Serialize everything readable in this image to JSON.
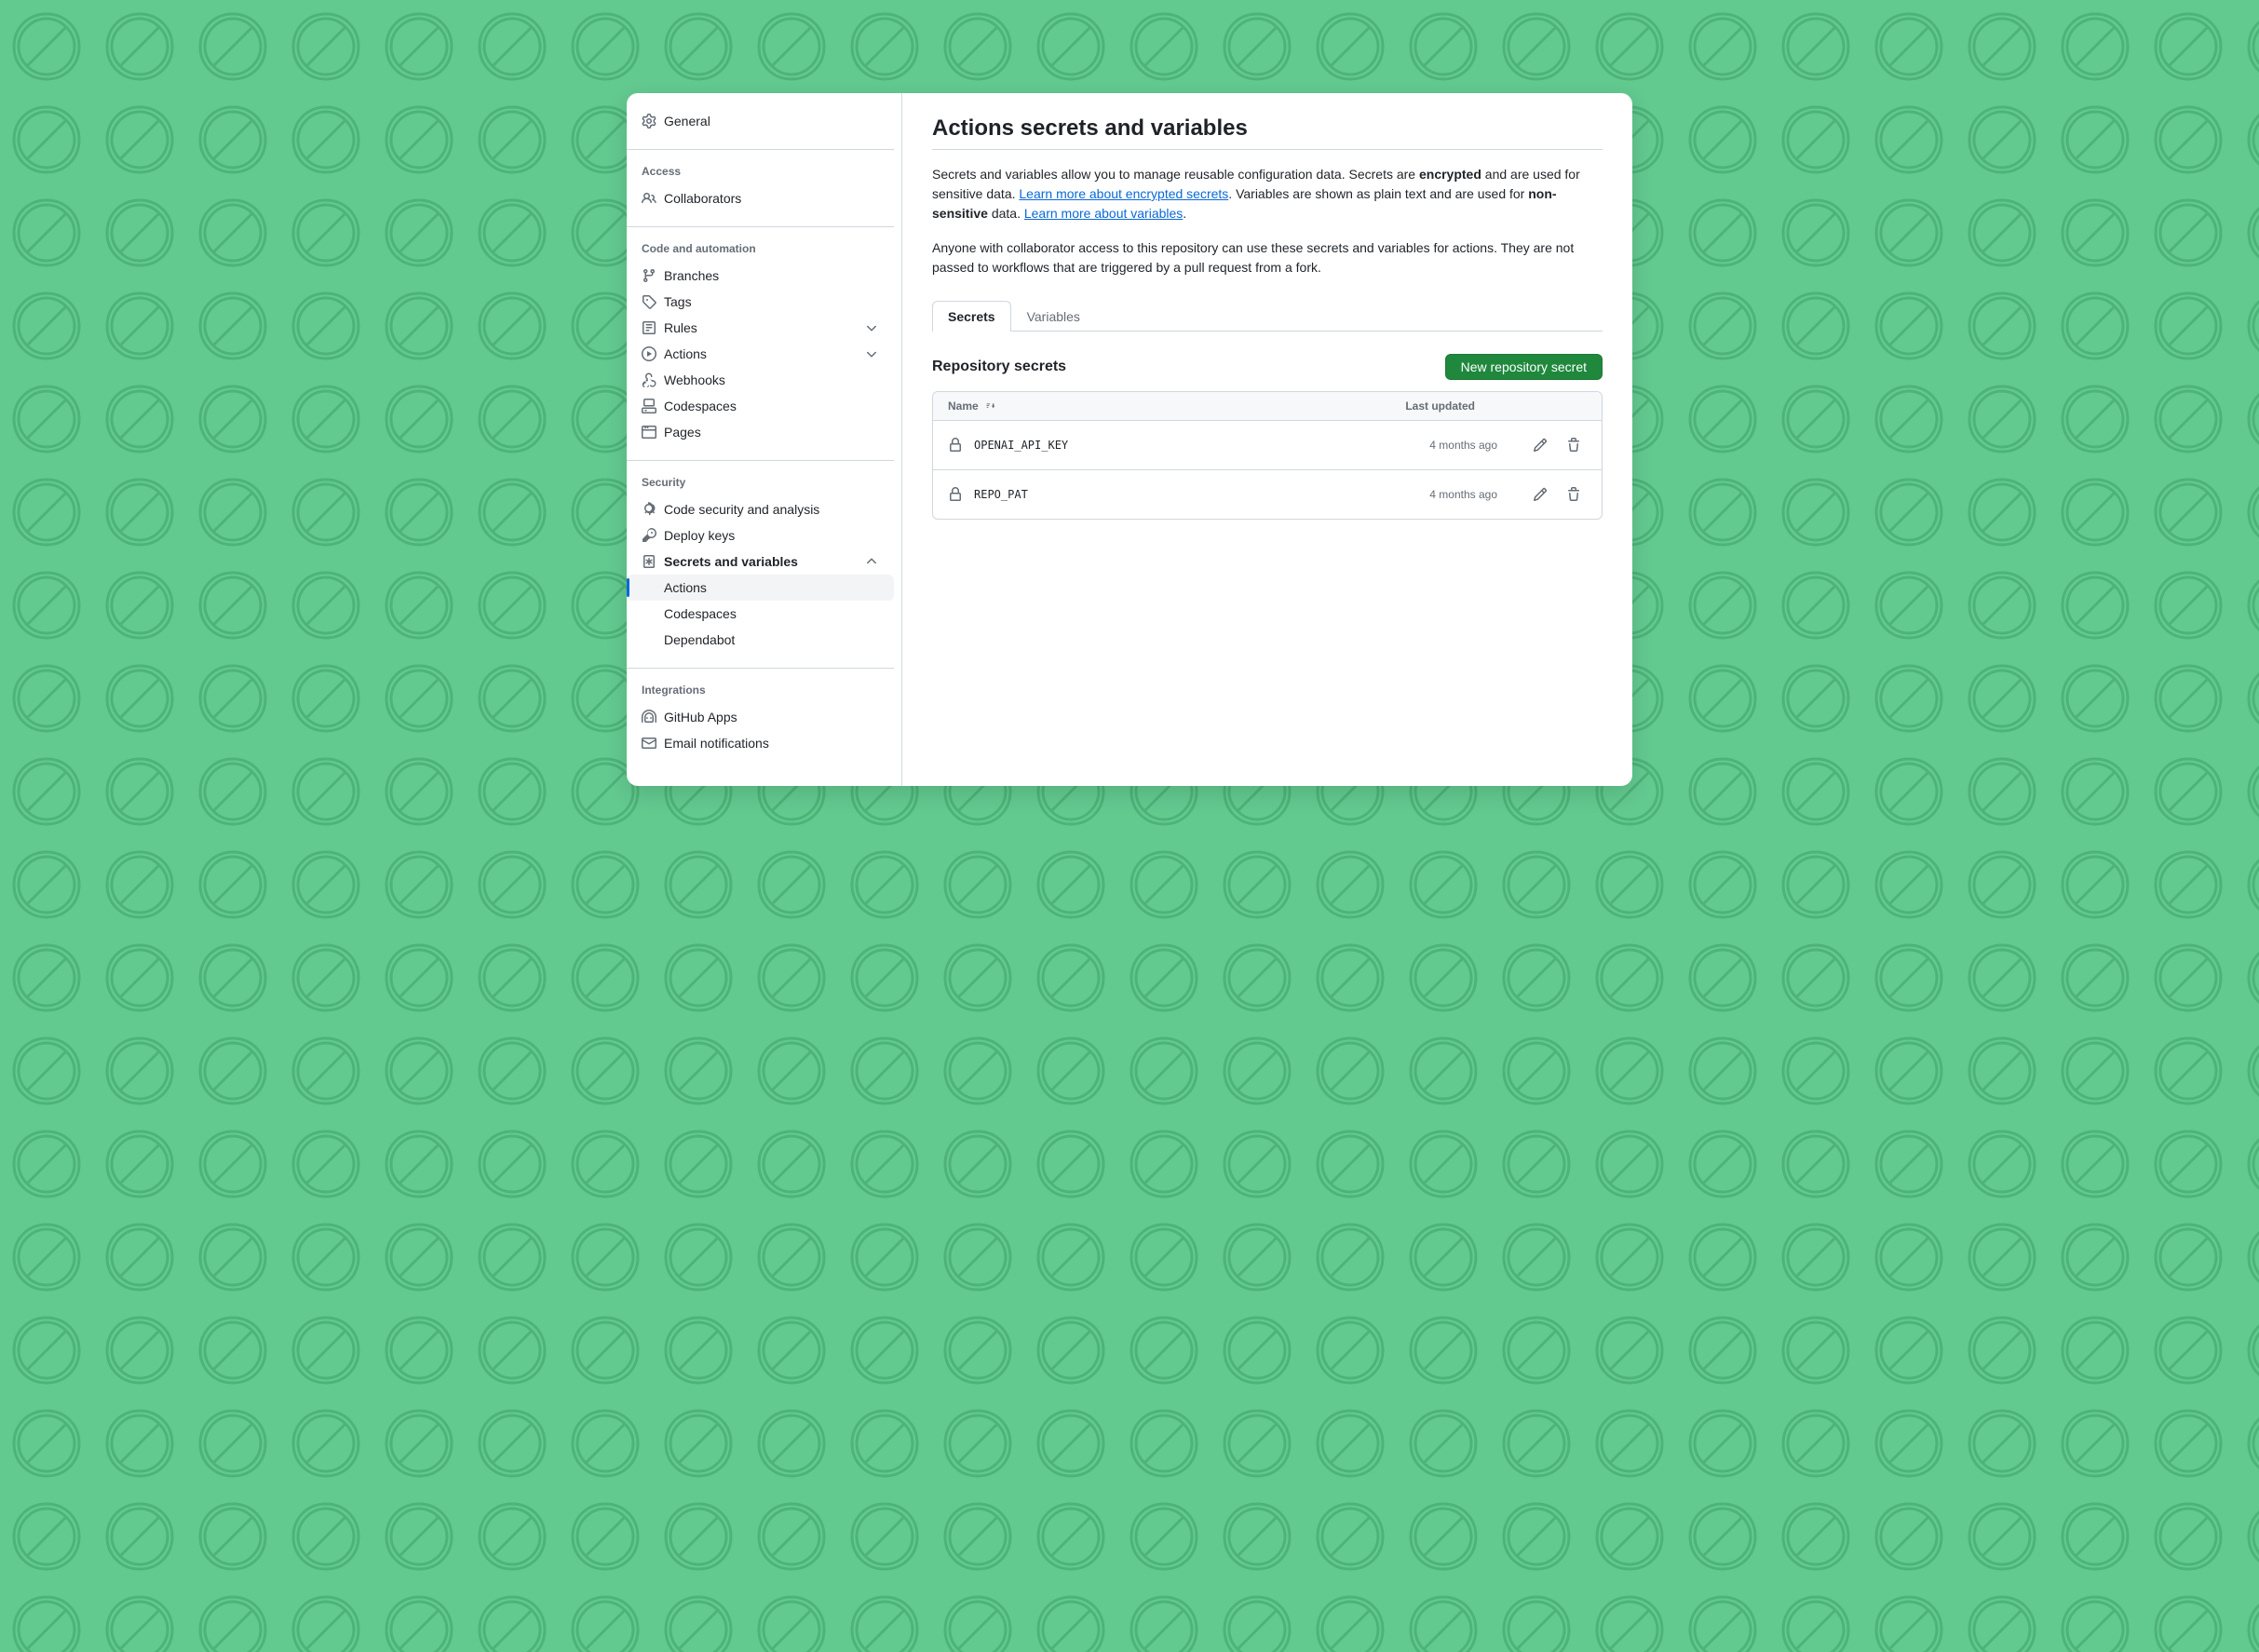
{
  "sidebar": {
    "general": "General",
    "sections": {
      "access": {
        "title": "Access",
        "collaborators": "Collaborators"
      },
      "code": {
        "title": "Code and automation",
        "branches": "Branches",
        "tags": "Tags",
        "rules": "Rules",
        "actions": "Actions",
        "webhooks": "Webhooks",
        "codespaces": "Codespaces",
        "pages": "Pages"
      },
      "security": {
        "title": "Security",
        "code_security": "Code security and analysis",
        "deploy_keys": "Deploy keys",
        "secrets": "Secrets and variables",
        "sub": {
          "actions": "Actions",
          "codespaces": "Codespaces",
          "dependabot": "Dependabot"
        }
      },
      "integrations": {
        "title": "Integrations",
        "github_apps": "GitHub Apps",
        "email": "Email notifications"
      }
    }
  },
  "main": {
    "title": "Actions secrets and variables",
    "desc1_a": "Secrets and variables allow you to manage reusable configuration data. Secrets are ",
    "desc1_b": "encrypted",
    "desc1_c": " and are used for sensitive data. ",
    "desc1_link1": "Learn more about encrypted secrets",
    "desc1_d": ". Variables are shown as plain text and are used for ",
    "desc1_e": "non-sensitive",
    "desc1_f": " data. ",
    "desc1_link2": "Learn more about variables",
    "desc1_g": ".",
    "desc2": "Anyone with collaborator access to this repository can use these secrets and variables for actions. They are not passed to workflows that are triggered by a pull request from a fork.",
    "tabs": {
      "secrets": "Secrets",
      "variables": "Variables"
    },
    "section_title": "Repository secrets",
    "new_btn": "New repository secret",
    "table": {
      "col_name": "Name",
      "col_updated": "Last updated",
      "rows": [
        {
          "name": "OPENAI_API_KEY",
          "updated": "4 months ago"
        },
        {
          "name": "REPO_PAT",
          "updated": "4 months ago"
        }
      ]
    }
  }
}
